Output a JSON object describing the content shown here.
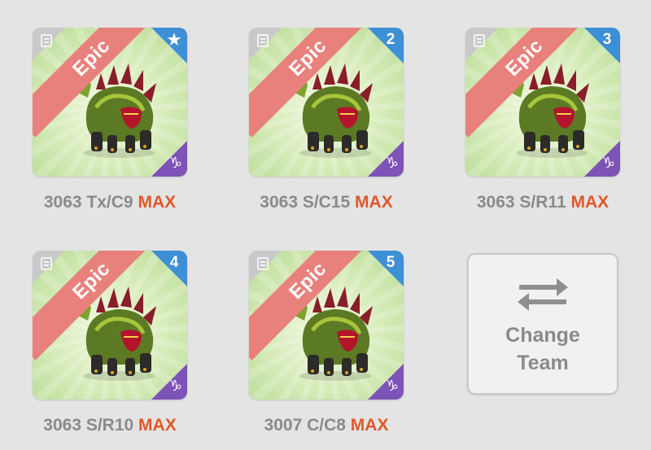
{
  "team": [
    {
      "rarity": "Epic",
      "slot_badge": "★",
      "badge_icon": "star-icon",
      "zodiac_glyph": "♑",
      "zodiac_icon": "capricorn-icon",
      "caption_stats": "3063 Tx/C9",
      "caption_max": "MAX"
    },
    {
      "rarity": "Epic",
      "slot_badge": "2",
      "badge_icon": "number-badge",
      "zodiac_glyph": "♑",
      "zodiac_icon": "capricorn-icon",
      "caption_stats": "3063 S/C15",
      "caption_max": "MAX"
    },
    {
      "rarity": "Epic",
      "slot_badge": "3",
      "badge_icon": "number-badge",
      "zodiac_glyph": "♑",
      "zodiac_icon": "capricorn-icon",
      "caption_stats": "3063 S/R11",
      "caption_max": "MAX"
    },
    {
      "rarity": "Epic",
      "slot_badge": "4",
      "badge_icon": "number-badge",
      "zodiac_glyph": "♑",
      "zodiac_icon": "capricorn-icon",
      "caption_stats": "3063 S/R10",
      "caption_max": "MAX"
    },
    {
      "rarity": "Epic",
      "slot_badge": "5",
      "badge_icon": "number-badge",
      "zodiac_glyph": "♑",
      "zodiac_icon": "capricorn-icon",
      "caption_stats": "3007 C/C8",
      "caption_max": "MAX"
    }
  ],
  "change_team": {
    "label": "Change\nTeam",
    "icon": "swap-arrows-icon"
  },
  "colors": {
    "background": "#e4e4e4",
    "rarity_band": "#e8817c",
    "slot_badge": "#3d8fd6",
    "zodiac_corner": "#7d53b8",
    "max_text": "#e0582a",
    "caption_text": "#8a8a8a"
  }
}
